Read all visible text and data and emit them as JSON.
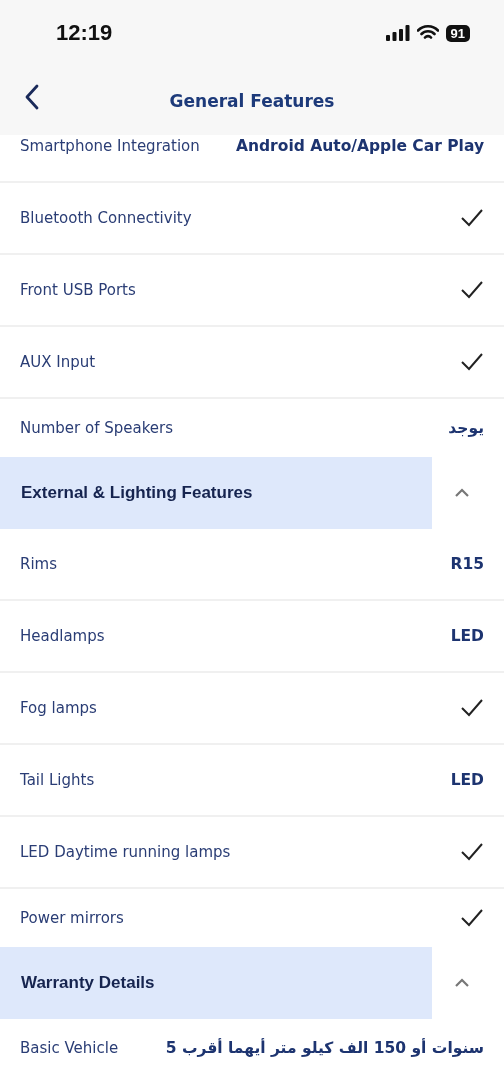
{
  "status_bar": {
    "time": "12:19",
    "battery": "91"
  },
  "nav": {
    "title": "General Features"
  },
  "sections": [
    {
      "rows": [
        {
          "label": "Smartphone Integration",
          "kind": "text",
          "value": "Android Auto/Apple Car Play"
        },
        {
          "label": "Bluetooth Connectivity",
          "kind": "check"
        },
        {
          "label": "Front USB Ports",
          "kind": "check"
        },
        {
          "label": "AUX Input",
          "kind": "check"
        },
        {
          "label": "Number of Speakers",
          "kind": "text",
          "value": "يوجد"
        }
      ]
    },
    {
      "title": "External & Lighting Features",
      "expanded": true,
      "rows": [
        {
          "label": "Rims",
          "kind": "text",
          "value": "R15"
        },
        {
          "label": "Headlamps",
          "kind": "text",
          "value": "LED"
        },
        {
          "label": "Fog lamps",
          "kind": "check"
        },
        {
          "label": "Tail Lights",
          "kind": "text",
          "value": "LED"
        },
        {
          "label": "LED Daytime running lamps",
          "kind": "check"
        },
        {
          "label": "Power mirrors",
          "kind": "check"
        }
      ]
    },
    {
      "title": "Warranty Details",
      "expanded": true,
      "rows": [
        {
          "label": "Basic Vehicle",
          "kind": "text",
          "value": "5 سنوات أو 150 الف كيلو متر أيهما أقرب"
        }
      ]
    }
  ]
}
